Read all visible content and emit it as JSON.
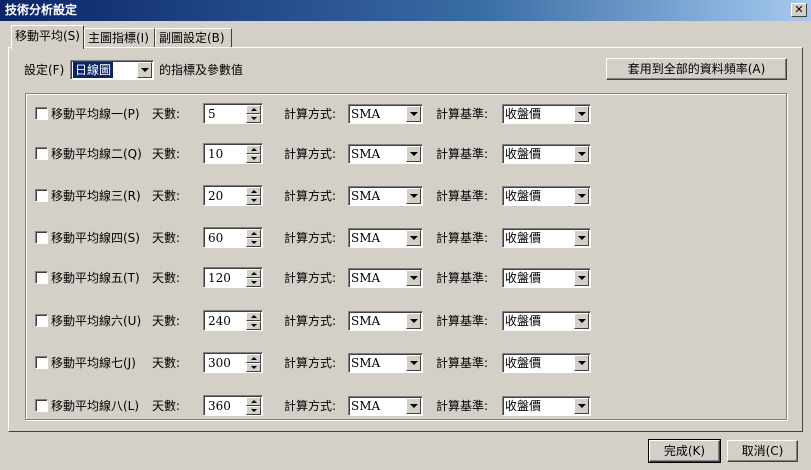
{
  "window": {
    "title": "技術分析設定",
    "close_glyph": "✕"
  },
  "tabs": [
    {
      "label": "移動平均(S)",
      "active": true
    },
    {
      "label": "主圖指標(I)",
      "active": false
    },
    {
      "label": "副圖設定(B)",
      "active": false
    }
  ],
  "setting": {
    "label": "設定(F)",
    "selected": "日線圖",
    "suffix": "的指標及參數值",
    "apply_all_button": "套用到全部的資料頻率(A)"
  },
  "field_labels": {
    "days": "天數:",
    "method": "計算方式:",
    "basis": "計算基準:"
  },
  "rows": [
    {
      "label": "移動平均線一(P)",
      "checked": false,
      "days": "5",
      "method": "SMA",
      "basis": "收盤價"
    },
    {
      "label": "移動平均線二(Q)",
      "checked": false,
      "days": "10",
      "method": "SMA",
      "basis": "收盤價"
    },
    {
      "label": "移動平均線三(R)",
      "checked": false,
      "days": "20",
      "method": "SMA",
      "basis": "收盤價"
    },
    {
      "label": "移動平均線四(S)",
      "checked": false,
      "days": "60",
      "method": "SMA",
      "basis": "收盤價"
    },
    {
      "label": "移動平均線五(T)",
      "checked": false,
      "days": "120",
      "method": "SMA",
      "basis": "收盤價"
    },
    {
      "label": "移動平均線六(U)",
      "checked": false,
      "days": "240",
      "method": "SMA",
      "basis": "收盤價"
    },
    {
      "label": "移動平均線七(J)",
      "checked": false,
      "days": "300",
      "method": "SMA",
      "basis": "收盤價"
    },
    {
      "label": "移動平均線八(L)",
      "checked": false,
      "days": "360",
      "method": "SMA",
      "basis": "收盤價"
    }
  ],
  "footer": {
    "ok_button": "完成(K)",
    "cancel_button": "取消(C)"
  }
}
